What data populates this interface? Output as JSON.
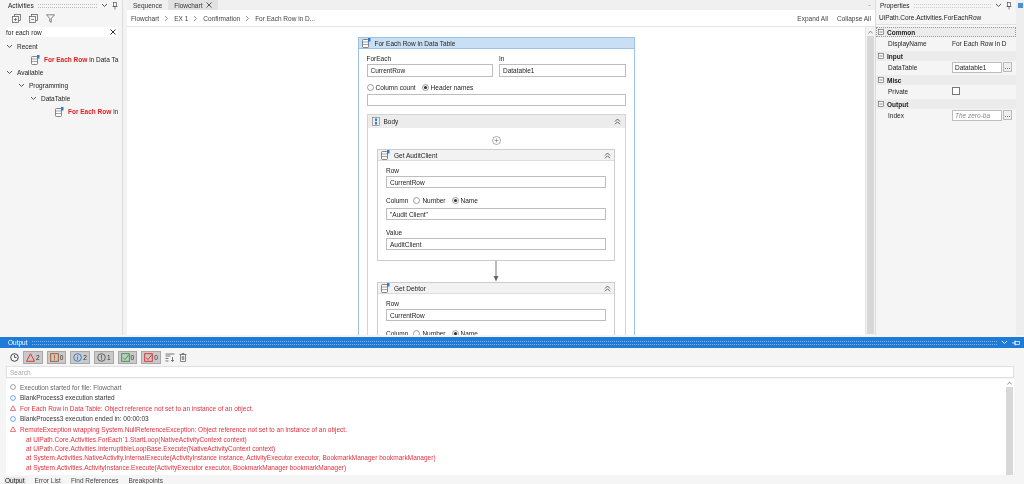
{
  "activities": {
    "title": "Activities",
    "search_value": "for each row",
    "tree": [
      {
        "label": "Recent",
        "expanded": true,
        "children": [
          {
            "label": "**For Each Row** in Data Ta",
            "kind": "activity"
          }
        ]
      },
      {
        "label": "Available",
        "expanded": true,
        "children": [
          {
            "label": "Programming",
            "expanded": true,
            "children": [
              {
                "label": "DataTable",
                "expanded": true,
                "children": [
                  {
                    "label": "**For Each Row** in",
                    "kind": "activity"
                  }
                ]
              }
            ]
          }
        ]
      }
    ]
  },
  "designer": {
    "tabs": [
      {
        "label": "Sequence",
        "selected": false
      },
      {
        "label": "Flowchart",
        "selected": true
      }
    ],
    "breadcrumb": [
      "Flowchart",
      "EX 1",
      "Confirmation",
      "For Each Row in D..."
    ],
    "actions": [
      "Expand All",
      "Collapse All"
    ],
    "activity": {
      "title": "For Each Row in Data Table",
      "foreach_label": "ForEach",
      "foreach_value": "CurrentRow",
      "in_label": "In",
      "in_value": "Datatable1",
      "options": [
        {
          "label": "Column count",
          "selected": false
        },
        {
          "label": "Header names",
          "selected": true
        }
      ],
      "body": {
        "title": "Body",
        "steps": [
          {
            "title": "Get AuditClient",
            "row_label": "Row",
            "row_value": "CurrentRow",
            "column_label": "Column",
            "column_options": [
              {
                "label": "Number",
                "selected": false
              },
              {
                "label": "Name",
                "selected": true
              }
            ],
            "column_value": "\"Audit Client\"",
            "value_label": "Value",
            "value_value": "AuditClient"
          },
          {
            "title": "Get Debtor",
            "row_label": "Row",
            "row_value": "CurrentRow",
            "column_label": "Column",
            "column_options": [
              {
                "label": "Number",
                "selected": false
              },
              {
                "label": "Name",
                "selected": true
              }
            ]
          }
        ]
      }
    }
  },
  "properties": {
    "title": "Properties",
    "type_name": "UiPath.Core.Activities.ForEachRow",
    "categories": [
      {
        "name": "Common",
        "selected": true,
        "rows": [
          {
            "name": "DisplayName",
            "kind": "text",
            "value": "For Each Row in D"
          }
        ]
      },
      {
        "name": "Input",
        "selected": false,
        "rows": [
          {
            "name": "DataTable",
            "kind": "field",
            "value": "Datatable1",
            "button": "..."
          }
        ]
      },
      {
        "name": "Misc",
        "selected": false,
        "rows": [
          {
            "name": "Private",
            "kind": "checkbox",
            "checked": false
          }
        ]
      },
      {
        "name": "Output",
        "selected": false,
        "rows": [
          {
            "name": "Index",
            "kind": "field",
            "placeholder": "The zero-ba",
            "button": "..."
          }
        ]
      }
    ]
  },
  "output": {
    "title": "Output",
    "filters": [
      {
        "kind": "error",
        "count": "2",
        "on": true
      },
      {
        "kind": "warning",
        "count": "0",
        "on": true
      },
      {
        "kind": "info",
        "count": "2",
        "on": true
      },
      {
        "kind": "trace",
        "count": "1",
        "on": true
      },
      {
        "kind": "success",
        "count": "0",
        "on": true
      },
      {
        "kind": "failed",
        "count": "0",
        "on": true
      }
    ],
    "search_placeholder": "Search",
    "lines": [
      {
        "kind": "trace",
        "text": "Execution started for file: Flowchart"
      },
      {
        "kind": "info",
        "text": "BlankProcess3 execution started"
      },
      {
        "kind": "error",
        "text": "For Each Row in Data Table: Object reference not set to an instance of an object."
      },
      {
        "kind": "info",
        "text": "BlankProcess3 execution ended in: 00:00:03"
      },
      {
        "kind": "error",
        "text": "RemoteException wrapping System.NullReferenceException: Object reference not set to an instance of an object.",
        "stack": [
          "at UiPath.Core.Activities.ForEach`1.StartLoop(NativeActivityContext context)",
          "at UiPath.Core.Activities.InterruptibleLoopBase.Execute(NativeActivityContext context)",
          "at System.Activities.NativeActivity.InternalExecute(ActivityInstance instance, ActivityExecutor executor, BookmarkManager bookmarkManager)",
          "at System.Activities.ActivityInstance.Execute(ActivityExecutor executor, BookmarkManager bookmarkManager)"
        ]
      }
    ],
    "bottom_tabs": [
      {
        "label": "Output",
        "selected": true
      },
      {
        "label": "Error List",
        "selected": false
      },
      {
        "label": "Find References",
        "selected": false
      },
      {
        "label": "Breakpoints",
        "selected": false
      }
    ]
  }
}
